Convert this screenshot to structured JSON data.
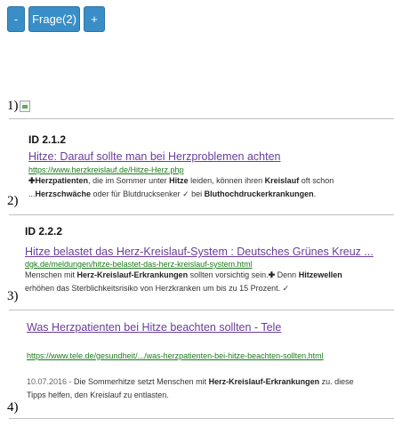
{
  "toolbar": {
    "minus_label": "-",
    "question_label": "Frage(2)",
    "plus_label": "+"
  },
  "numbers": [
    "1)",
    "2)",
    "3)",
    "4)"
  ],
  "results": [
    {
      "id": "ID 2.1.2",
      "title": "Hitze: Darauf sollte man bei Herzproblemen achten",
      "url": "https://www.herzkreislauf.de/Hitze-Herz.php",
      "snippet": {
        "l1": [
          "✚",
          "Herzpatienten",
          ", die im Sommer unter ",
          "Hitze",
          " leiden, können ihren ",
          "Kreislauf",
          " oft schon"
        ],
        "l2": [
          "...",
          "Herzschwäche",
          " oder für Blutdrucksenker ✓ bei ",
          "Bluthochdruckerkrankungen",
          "."
        ]
      }
    },
    {
      "id": "ID 2.2.2",
      "title": "Hitze belastet das Herz-Kreislauf-System : Deutsches Grünes Kreuz ...",
      "url": "dgk.de/meldungen/hitze-belastet-das-herz-kreislauf-system.html",
      "snippet": {
        "l1": [
          "Menschen mit ",
          "Herz-Kreislauf-Erkrankungen",
          " sollten vorsichtig sein.",
          "✚",
          " Denn ",
          "Hitzewellen"
        ],
        "l2": [
          "erhöhen das Sterblichkeitsrisiko von Herzkranken um bis zu 15 Prozent. ✓"
        ]
      }
    },
    {
      "title": "Was Herzpatienten bei Hitze beachten sollten - Tele",
      "url": "https://www.tele.de/gesundheit/.../was-herzpatienten-bei-hitze-beachten-sollten.html",
      "snippet": {
        "date": "10.07.2016 - ",
        "l1": [
          "Die Sommerhitze setzt Menschen mit ",
          "Herz-Kreislauf-Erkrankungen",
          " zu. diese"
        ],
        "l2": [
          "Tipps helfen, den Kreislauf zu entlasten."
        ]
      }
    }
  ]
}
